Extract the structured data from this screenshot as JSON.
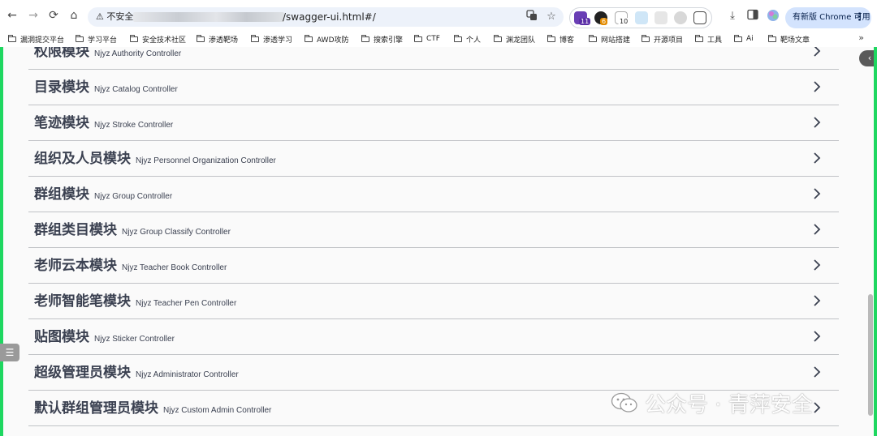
{
  "browser": {
    "security_label": "不安全",
    "url_path": "/swagger-ui.html#/",
    "update_label": "有新版 Chrome 可用",
    "extension_badges": [
      "11",
      "6",
      "10"
    ]
  },
  "bookmarks": [
    "漏洞提交平台",
    "学习平台",
    "安全技术社区",
    "渗透靶场",
    "渗透学习",
    "AWD攻防",
    "搜索引擎",
    "CTF",
    "个人",
    "渊龙团队",
    "博客",
    "网站搭建",
    "开源项目",
    "工具",
    "Ai",
    "靶场文章"
  ],
  "controllers": [
    {
      "name": "权限模块",
      "desc": "Njyz Authority Controller"
    },
    {
      "name": "目录模块",
      "desc": "Njyz Catalog Controller"
    },
    {
      "name": "笔迹模块",
      "desc": "Njyz Stroke Controller"
    },
    {
      "name": "组织及人员模块",
      "desc": "Njyz Personnel Organization Controller"
    },
    {
      "name": "群组模块",
      "desc": "Njyz Group Controller"
    },
    {
      "name": "群组类目模块",
      "desc": "Njyz Group Classify Controller"
    },
    {
      "name": "老师云本模块",
      "desc": "Njyz Teacher Book Controller"
    },
    {
      "name": "老师智能笔模块",
      "desc": "Njyz Teacher Pen Controller"
    },
    {
      "name": "贴图模块",
      "desc": "Njyz Sticker Controller"
    },
    {
      "name": "超级管理员模块",
      "desc": "Njyz Administrator Controller"
    },
    {
      "name": "默认群组管理员模块",
      "desc": "Njyz Custom Admin Controller"
    }
  ],
  "watermark": {
    "text": "公众号 · 青萍安全"
  },
  "colors": {
    "accent_green": "#1ed760",
    "text": "#3b4151",
    "page_bg": "#fafafa"
  }
}
